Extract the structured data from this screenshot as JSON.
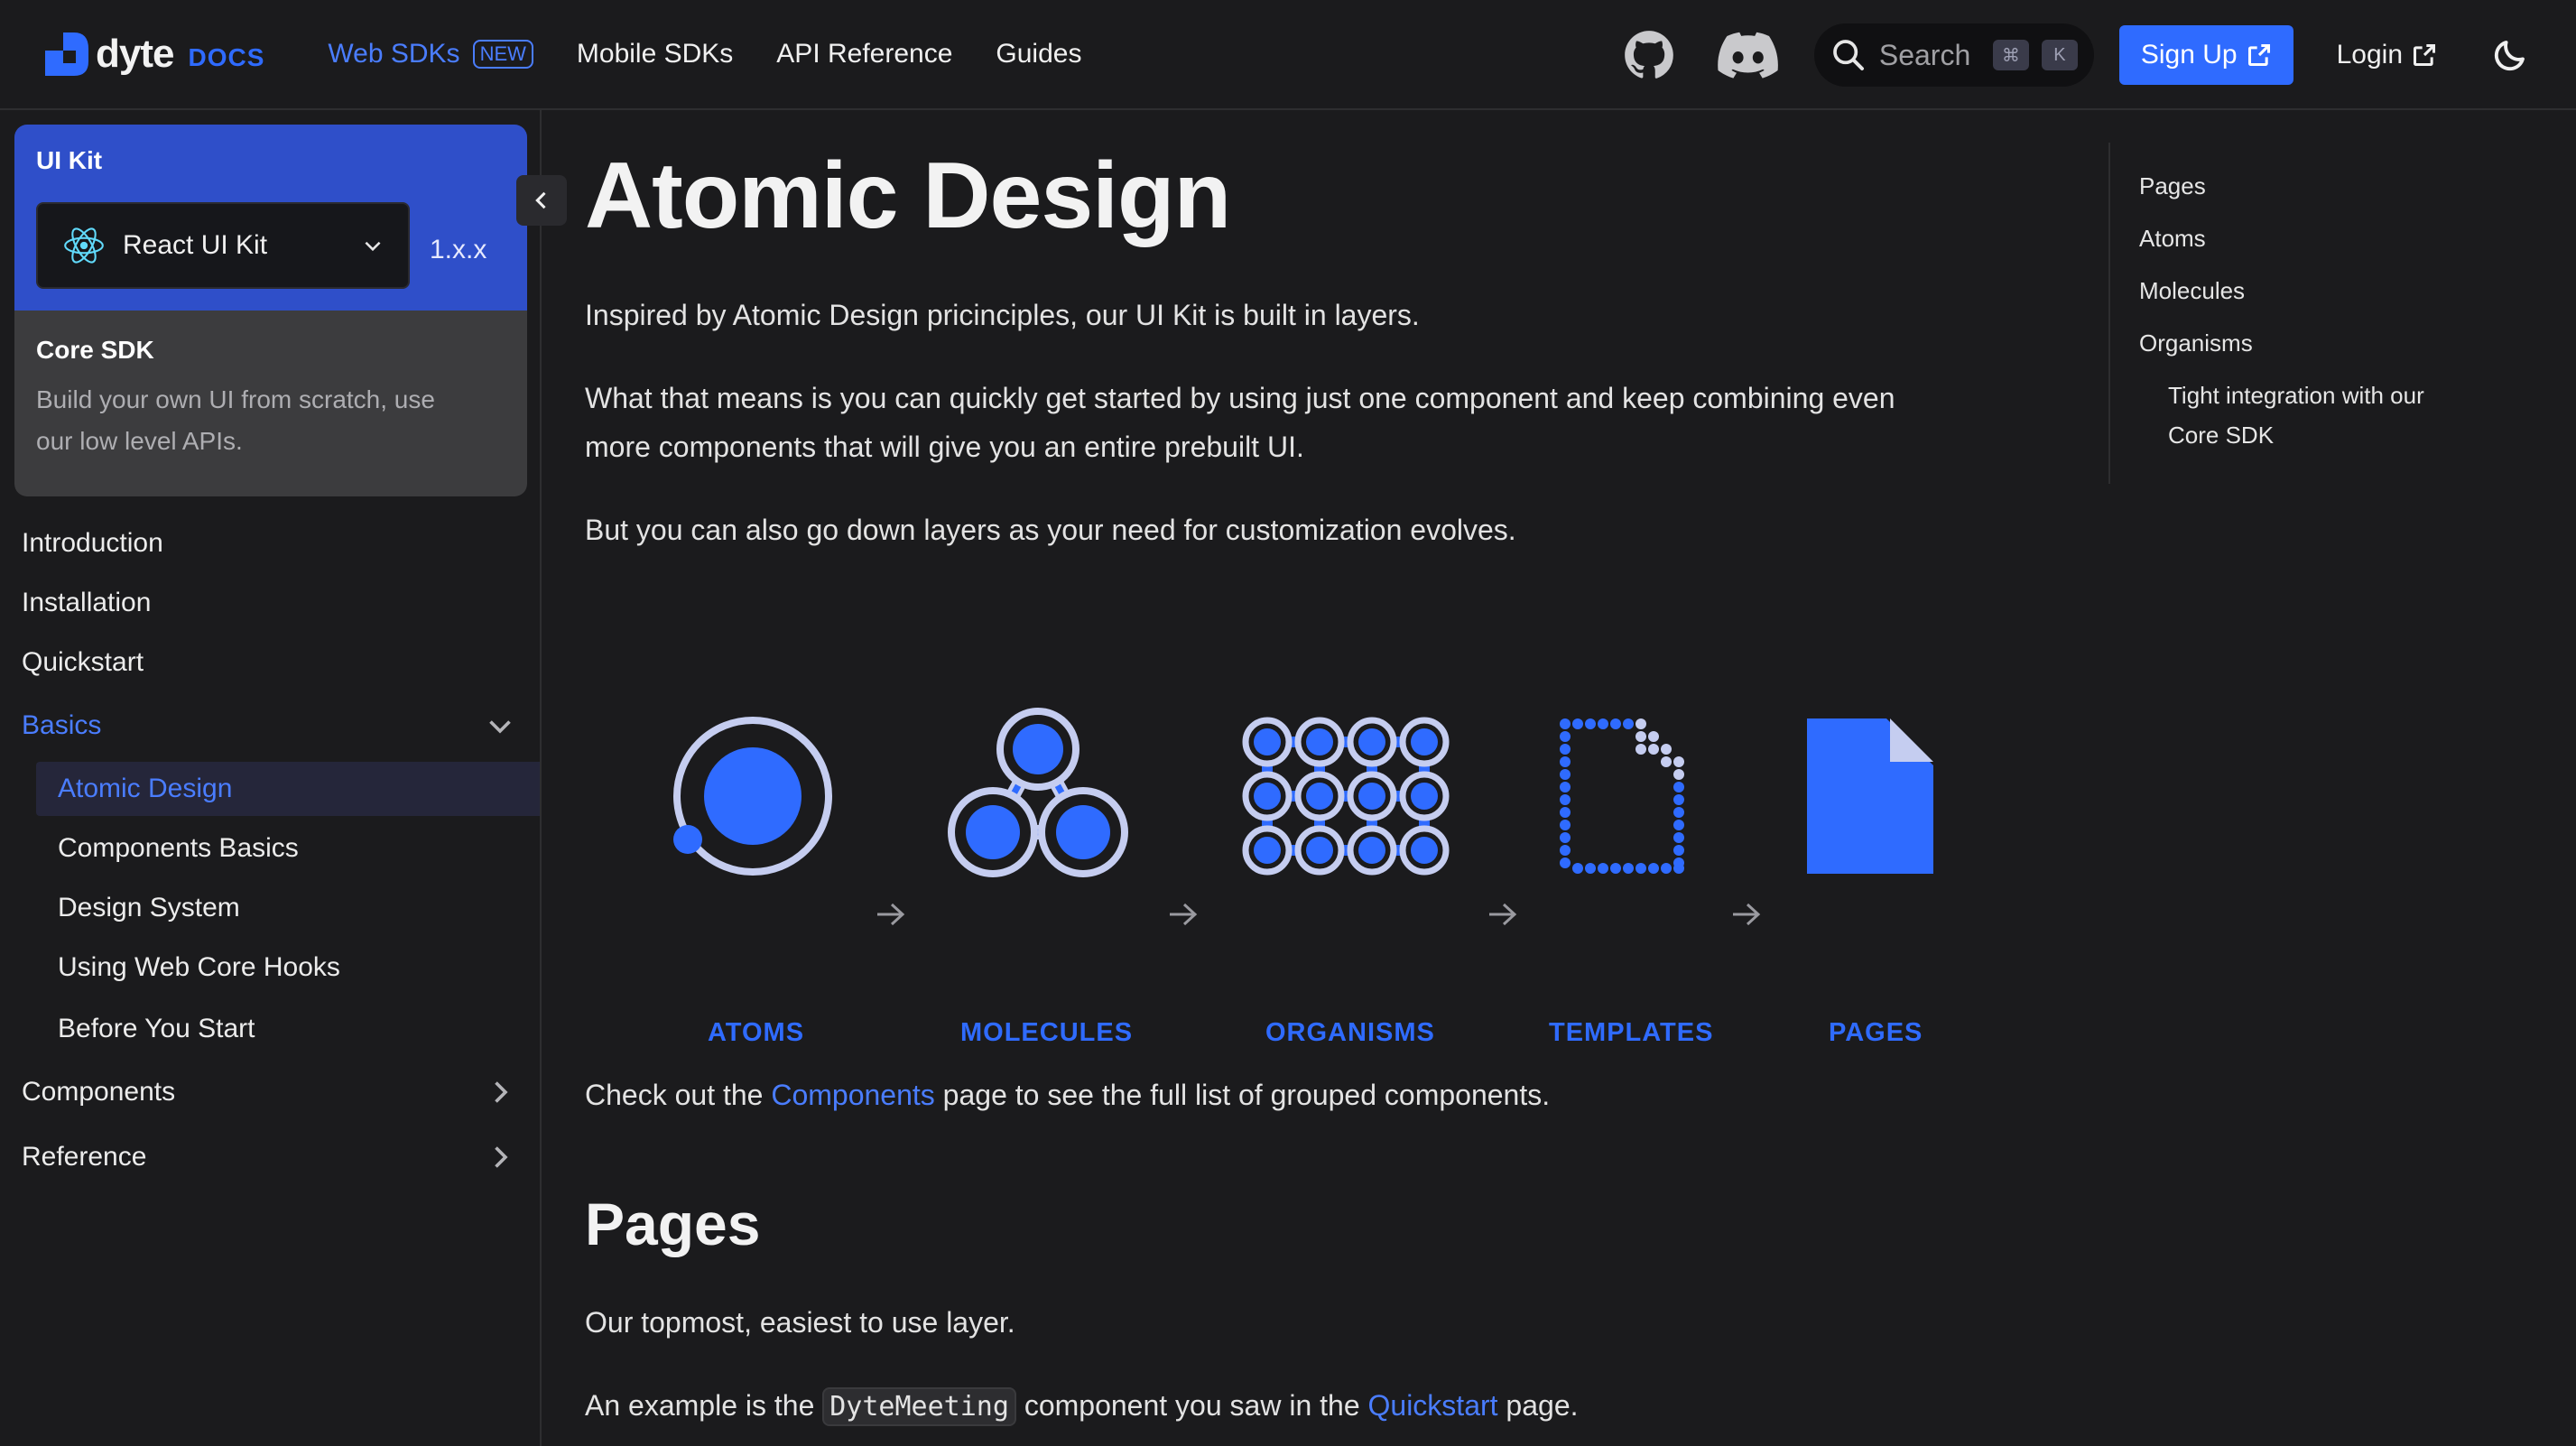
{
  "navbar": {
    "logo_word": "dyte",
    "logo_docs": "DOCS",
    "links": [
      {
        "label": "Web SDKs",
        "badge": "NEW"
      },
      {
        "label": "Mobile SDKs"
      },
      {
        "label": "API Reference"
      },
      {
        "label": "Guides"
      }
    ],
    "search_placeholder": "Search",
    "search_kbd": [
      "⌘",
      "K"
    ],
    "signup": "Sign Up",
    "login": "Login",
    "icons": [
      "github-icon",
      "discord-icon",
      "search-icon",
      "external-link-icon",
      "moon-icon"
    ]
  },
  "sidebar": {
    "ui_kit": {
      "title": "UI Kit",
      "selected_kit": "React UI Kit",
      "version": "1.x.x"
    },
    "core_sdk": {
      "title": "Core SDK",
      "description_line1": "Build your own UI from scratch, use",
      "description_line2": "our low level APIs."
    },
    "items": [
      {
        "label": "Introduction"
      },
      {
        "label": "Installation"
      },
      {
        "label": "Quickstart"
      },
      {
        "label": "Basics"
      },
      {
        "label": "Atomic Design"
      },
      {
        "label": "Components Basics"
      },
      {
        "label": "Design System"
      },
      {
        "label": "Using Web Core Hooks"
      },
      {
        "label": "Before You Start"
      },
      {
        "label": "Components"
      },
      {
        "label": "Reference"
      }
    ]
  },
  "main": {
    "title": "Atomic Design",
    "p1": "Inspired by Atomic Design pricinciples, our UI Kit is built in layers.",
    "p2_line1": "What that means is you can quickly get started by using just one component and keep combining even",
    "p2_line2": "more components that will give you an entire prebuilt UI.",
    "p3": "But you can also go down layers as your need for customization evolves.",
    "diagram_labels": [
      "ATOMS",
      "MOLECULES",
      "ORGANISMS",
      "TEMPLATES",
      "PAGES"
    ],
    "p4_before": "Check out the ",
    "p4_link": "Components",
    "p4_after": " page to see the full list of grouped components.",
    "h2": "Pages",
    "p5": "Our topmost, easiest to use layer.",
    "p6_before": "An example is the ",
    "p6_code": "DyteMeeting",
    "p6_middle": " component you saw in the ",
    "p6_link": "Quickstart",
    "p6_after": " page."
  },
  "toc": {
    "items": [
      "Pages",
      "Atoms",
      "Molecules",
      "Organisms"
    ],
    "sub_item_line1": "Tight integration with our",
    "sub_item_line2": "Core SDK"
  },
  "colors": {
    "accent": "#2f6bff",
    "link": "#4a7dff",
    "background": "#1b1b1d",
    "ui_kit_card": "#2f4fc9",
    "core_sdk_card": "#3c3c3e"
  }
}
